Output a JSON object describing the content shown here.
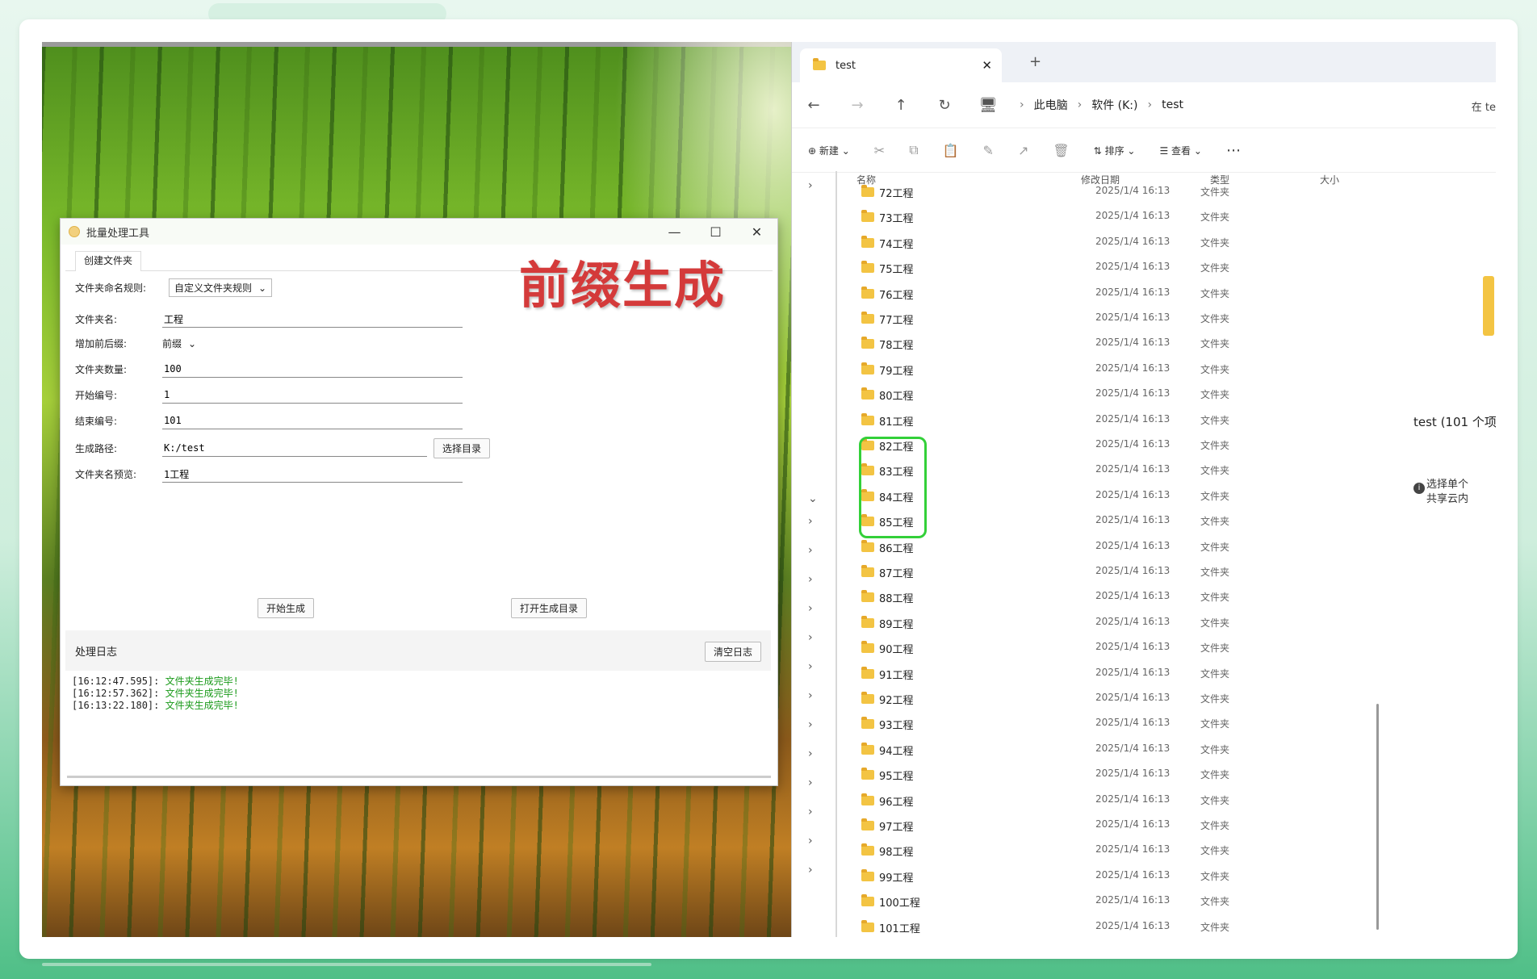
{
  "app": {
    "title": "批量处理工具",
    "tab": "创建文件夹",
    "heading": "前缀生成",
    "fields": {
      "naming_rule_label": "文件夹命名规则:",
      "naming_rule_value": "自定义文件夹规则",
      "folder_name_label": "文件夹名:",
      "folder_name_value": "工程",
      "affix_label": "增加前后缀:",
      "affix_value": "前缀",
      "count_label": "文件夹数量:",
      "count_value": "100",
      "start_label": "开始编号:",
      "start_value": "1",
      "end_label": "结束编号:",
      "end_value": "101",
      "path_label": "生成路径:",
      "path_value": "K:/test",
      "choose_dir_button": "选择目录",
      "preview_label": "文件夹名预览:",
      "preview_value": "1工程"
    },
    "start_button": "开始生成",
    "open_dir_button": "打开生成目录",
    "log_title": "处理日志",
    "clear_log_button": "清空日志",
    "log_entries": [
      {
        "time": "[16:12:47.595]:",
        "msg": "文件夹生成完毕!"
      },
      {
        "time": "[16:12:57.362]:",
        "msg": "文件夹生成完毕!"
      },
      {
        "time": "[16:13:22.180]:",
        "msg": "文件夹生成完毕!"
      }
    ]
  },
  "explorer": {
    "tab_title": "test",
    "breadcrumbs": [
      "此电脑",
      "软件 (K:)",
      "test"
    ],
    "search_hint": "在 te",
    "commands": {
      "new": "新建",
      "sort": "排序",
      "view": "查看"
    },
    "columns": {
      "name": "名称",
      "modified": "修改日期",
      "type": "类型",
      "size": "大小"
    },
    "rows": [
      {
        "name": "72工程",
        "date": "2025/1/4 16:13",
        "type": "文件夹"
      },
      {
        "name": "73工程",
        "date": "2025/1/4 16:13",
        "type": "文件夹"
      },
      {
        "name": "74工程",
        "date": "2025/1/4 16:13",
        "type": "文件夹"
      },
      {
        "name": "75工程",
        "date": "2025/1/4 16:13",
        "type": "文件夹"
      },
      {
        "name": "76工程",
        "date": "2025/1/4 16:13",
        "type": "文件夹"
      },
      {
        "name": "77工程",
        "date": "2025/1/4 16:13",
        "type": "文件夹"
      },
      {
        "name": "78工程",
        "date": "2025/1/4 16:13",
        "type": "文件夹"
      },
      {
        "name": "79工程",
        "date": "2025/1/4 16:13",
        "type": "文件夹"
      },
      {
        "name": "80工程",
        "date": "2025/1/4 16:13",
        "type": "文件夹"
      },
      {
        "name": "81工程",
        "date": "2025/1/4 16:13",
        "type": "文件夹"
      },
      {
        "name": "82工程",
        "date": "2025/1/4 16:13",
        "type": "文件夹"
      },
      {
        "name": "83工程",
        "date": "2025/1/4 16:13",
        "type": "文件夹"
      },
      {
        "name": "84工程",
        "date": "2025/1/4 16:13",
        "type": "文件夹"
      },
      {
        "name": "85工程",
        "date": "2025/1/4 16:13",
        "type": "文件夹"
      },
      {
        "name": "86工程",
        "date": "2025/1/4 16:13",
        "type": "文件夹"
      },
      {
        "name": "87工程",
        "date": "2025/1/4 16:13",
        "type": "文件夹"
      },
      {
        "name": "88工程",
        "date": "2025/1/4 16:13",
        "type": "文件夹"
      },
      {
        "name": "89工程",
        "date": "2025/1/4 16:13",
        "type": "文件夹"
      },
      {
        "name": "90工程",
        "date": "2025/1/4 16:13",
        "type": "文件夹"
      },
      {
        "name": "91工程",
        "date": "2025/1/4 16:13",
        "type": "文件夹"
      },
      {
        "name": "92工程",
        "date": "2025/1/4 16:13",
        "type": "文件夹"
      },
      {
        "name": "93工程",
        "date": "2025/1/4 16:13",
        "type": "文件夹"
      },
      {
        "name": "94工程",
        "date": "2025/1/4 16:13",
        "type": "文件夹"
      },
      {
        "name": "95工程",
        "date": "2025/1/4 16:13",
        "type": "文件夹"
      },
      {
        "name": "96工程",
        "date": "2025/1/4 16:13",
        "type": "文件夹"
      },
      {
        "name": "97工程",
        "date": "2025/1/4 16:13",
        "type": "文件夹"
      },
      {
        "name": "98工程",
        "date": "2025/1/4 16:13",
        "type": "文件夹"
      },
      {
        "name": "99工程",
        "date": "2025/1/4 16:13",
        "type": "文件夹"
      },
      {
        "name": "100工程",
        "date": "2025/1/4 16:13",
        "type": "文件夹"
      },
      {
        "name": "101工程",
        "date": "2025/1/4 16:13",
        "type": "文件夹"
      }
    ],
    "details_title": "test (101 个项",
    "details_info": [
      "选择单个",
      "共享云内"
    ]
  }
}
